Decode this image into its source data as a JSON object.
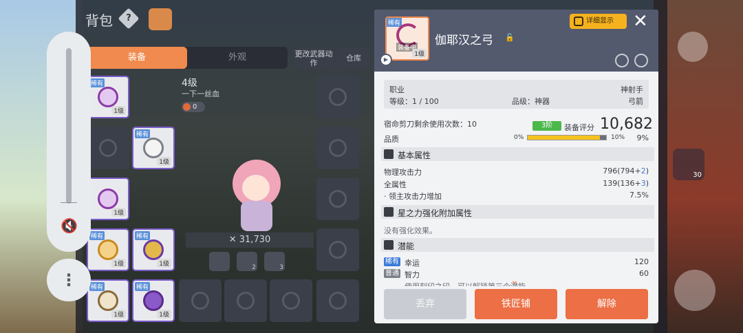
{
  "inventory": {
    "title": "背包",
    "help_symbol": "?",
    "tabs": [
      "装备",
      "外观"
    ],
    "buttons": {
      "change_weapon_action": "更改武器动作",
      "warehouse": "仓库"
    },
    "selected": {
      "level": "4级",
      "subtitle": "一下一丝血",
      "coin": "0"
    },
    "power": "31,730",
    "slot_badge_rare": "稀有",
    "slot_level": "1级",
    "set_slots": [
      "",
      "2",
      "3"
    ]
  },
  "overlay": {
    "mute_symbol": "🔇",
    "more_symbol": "⋮"
  },
  "detail": {
    "rarity": "稀有",
    "equipped_tag": "装备中",
    "item_level": "1级",
    "name": "伽耶汉之弓",
    "lock_symbol": "🔓",
    "detail_button": "详细显示",
    "close_symbol": "✕",
    "job_label": "职业",
    "job_value": "神射手",
    "level_label": "等级：",
    "level_value": "1 / 100",
    "grade_label": "品级：",
    "grade_value": "神器",
    "weapon_type": "弓箭",
    "scissors_label": "宿命剪刀剩余使用次数：",
    "scissors_value": "10",
    "tier_badge": "3阶",
    "score_label": "装备评分",
    "score": "10,682",
    "quality_label": "品质",
    "quality_min": "0%",
    "quality_mark": "10%",
    "quality_value": "9%",
    "quality_fraction": 0.92,
    "sections": {
      "basic": "基本属性",
      "starforce": "星之力强化附加属性",
      "potential": "潜能"
    },
    "stats": [
      {
        "name": "物理攻击力",
        "base": "796(794+",
        "bonus": "2",
        "close": ")"
      },
      {
        "name": "全属性",
        "base": "139(136+",
        "bonus": "3",
        "close": ")"
      },
      {
        "name": "· 领主攻击力增加",
        "base": "7.5%",
        "bonus": "",
        "close": ""
      }
    ],
    "starforce_text": "没有强化效果。",
    "potential": [
      {
        "grade": "稀有",
        "name": "幸运",
        "value": "120"
      },
      {
        "grade": "普通",
        "name": "智力",
        "value": "60"
      }
    ],
    "truncated_line": "使用刻印之印，可以解锁第三个潜能",
    "actions": {
      "discard": "丢弃",
      "blacksmith": "铁匠铺",
      "disassemble": "解除"
    }
  },
  "hud": {
    "potion_count": "30"
  }
}
